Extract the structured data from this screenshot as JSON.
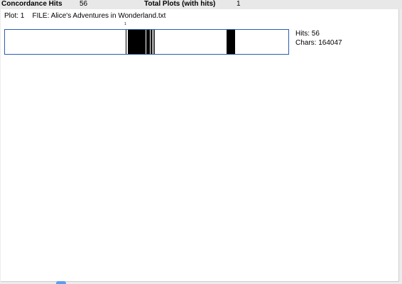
{
  "header": {
    "concordance_hits_label": "Concordance Hits",
    "concordance_hits_value": "56",
    "total_plots_label": "Total Plots (with hits)",
    "total_plots_value": "1"
  },
  "plot": {
    "plot_label": "Plot: 1",
    "file_label": "FILE: Alice's Adventures in Wonderland.txt",
    "hits_text": "Hits: 56",
    "chars_text": "Chars: 164047",
    "total_chars": 164047,
    "first_hit_number_label": "1",
    "hit_positions_fraction": [
      0.4266,
      0.4341,
      0.4366,
      0.4386,
      0.4406,
      0.4426,
      0.4441,
      0.4456,
      0.4471,
      0.4486,
      0.4501,
      0.4516,
      0.4531,
      0.4546,
      0.4561,
      0.4576,
      0.4591,
      0.4606,
      0.4621,
      0.4636,
      0.4651,
      0.4666,
      0.4681,
      0.4696,
      0.4716,
      0.4736,
      0.4756,
      0.4776,
      0.4796,
      0.4816,
      0.4841,
      0.4866,
      0.4891,
      0.4916,
      0.4946,
      0.4976,
      0.5006,
      0.5036,
      0.5066,
      0.5096,
      0.5126,
      0.5171,
      0.5216,
      0.5266,
      0.7828,
      0.7853,
      0.7878,
      0.7903,
      0.7928,
      0.7953,
      0.7978,
      0.8003,
      0.8028,
      0.8053,
      0.8078,
      0.8103
    ]
  }
}
